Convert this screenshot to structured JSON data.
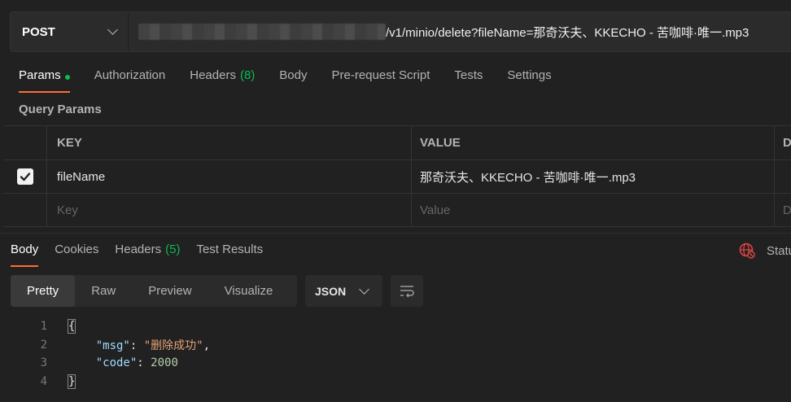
{
  "request": {
    "method": "POST",
    "url_path": "/v1/minio/delete?fileName=那奇沃夫、KKECHO - 苦咖啡·唯一.mp3"
  },
  "request_tabs": [
    {
      "label": "Params",
      "active": true
    },
    {
      "label": "Authorization"
    },
    {
      "label": "Headers",
      "count": "(8)"
    },
    {
      "label": "Body"
    },
    {
      "label": "Pre-request Script"
    },
    {
      "label": "Tests"
    },
    {
      "label": "Settings"
    }
  ],
  "query_params": {
    "title": "Query Params",
    "columns": {
      "key": "KEY",
      "value": "VALUE",
      "description": "D"
    },
    "rows": [
      {
        "checked": true,
        "key": "fileName",
        "value": "那奇沃夫、KKECHO - 苦咖啡·唯一.mp3"
      }
    ],
    "placeholder": {
      "key": "Key",
      "value": "Value",
      "description": "D"
    }
  },
  "response_tabs": [
    {
      "label": "Body",
      "active": true
    },
    {
      "label": "Cookies"
    },
    {
      "label": "Headers",
      "count": "(5)"
    },
    {
      "label": "Test Results"
    }
  ],
  "status_label": "Statu",
  "view_modes": [
    "Pretty",
    "Raw",
    "Preview",
    "Visualize"
  ],
  "active_view": "Pretty",
  "format": "JSON",
  "response_body": {
    "line_numbers": [
      "1",
      "2",
      "3",
      "4"
    ],
    "open_brace": "{",
    "close_brace": "}",
    "fields": [
      {
        "key": "\"msg\"",
        "value": "\"删除成功\"",
        "trailing": ","
      },
      {
        "key": "\"code\"",
        "value": "2000",
        "trailing": ""
      }
    ]
  },
  "colors": {
    "accent": "#ff6c37",
    "success": "#0cbb52",
    "background": "#212121"
  }
}
